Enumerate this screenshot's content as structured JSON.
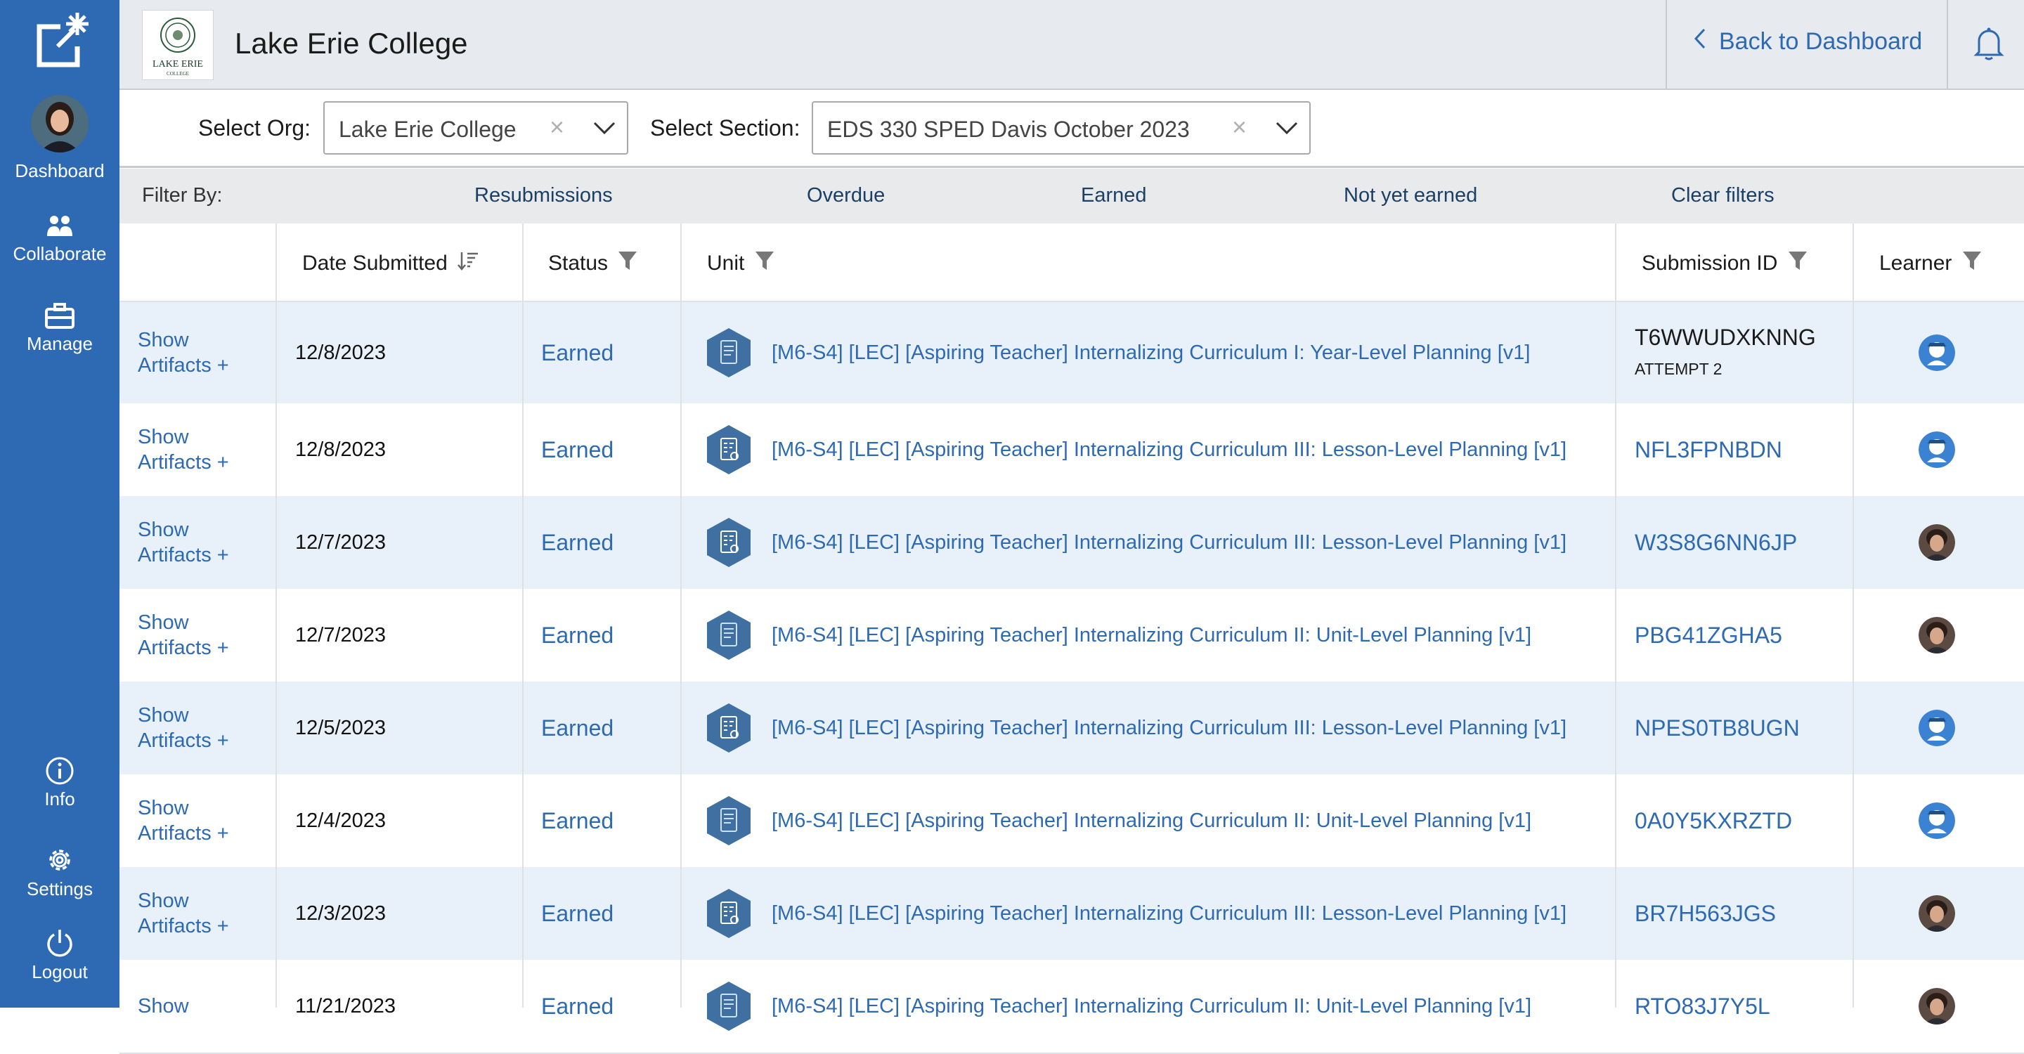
{
  "sidebar": {
    "items": [
      {
        "label": "Dashboard",
        "icon": "user-avatar"
      },
      {
        "label": "Collaborate",
        "icon": "people-icon"
      },
      {
        "label": "Manage",
        "icon": "briefcase-icon"
      },
      {
        "label": "Info",
        "icon": "info-icon"
      },
      {
        "label": "Settings",
        "icon": "gear-icon"
      },
      {
        "label": "Logout",
        "icon": "power-icon"
      }
    ]
  },
  "header": {
    "org_name": "Lake Erie College",
    "brand_text": "LAKE ERIE",
    "brand_subtext": "COLLEGE",
    "back_label": "Back to Dashboard"
  },
  "selects": {
    "org_label": "Select Org:",
    "org_value": "Lake Erie College",
    "section_label": "Select Section:",
    "section_value": "EDS 330 SPED Davis October 2023",
    "clear_glyph": "×"
  },
  "filters": {
    "label": "Filter By:",
    "resubmissions": "Resubmissions",
    "overdue": "Overdue",
    "earned": "Earned",
    "not_yet_earned": "Not yet earned",
    "clear": "Clear filters"
  },
  "table": {
    "columns": {
      "date": "Date Submitted",
      "status": "Status",
      "unit": "Unit",
      "submission_id": "Submission ID",
      "learner": "Learner"
    },
    "rows": [
      {
        "show": "Show Artifacts +",
        "date": "12/8/2023",
        "status": "Earned",
        "unit": "[M6-S4] [LEC] [Aspiring Teacher] Internalizing Curriculum I: Year-Level Planning [v1]",
        "submission_id": "T6WWUDXKNNG",
        "attempt": "ATTEMPT 2",
        "learner": "generic-avatar"
      },
      {
        "show": "Show Artifacts +",
        "date": "12/8/2023",
        "status": "Earned",
        "unit": "[M6-S4] [LEC] [Aspiring Teacher] Internalizing Curriculum III: Lesson-Level Planning [v1]",
        "submission_id": "NFL3FPNBDN",
        "learner": "generic-avatar"
      },
      {
        "show": "Show Artifacts +",
        "date": "12/7/2023",
        "status": "Earned",
        "unit": "[M6-S4] [LEC] [Aspiring Teacher] Internalizing Curriculum III: Lesson-Level Planning [v1]",
        "submission_id": "W3S8G6NN6JP",
        "learner": "photo-avatar"
      },
      {
        "show": "Show Artifacts +",
        "date": "12/7/2023",
        "status": "Earned",
        "unit": "[M6-S4] [LEC] [Aspiring Teacher] Internalizing Curriculum II: Unit-Level Planning [v1]",
        "submission_id": "PBG41ZGHA5",
        "learner": "photo-avatar"
      },
      {
        "show": "Show Artifacts +",
        "date": "12/5/2023",
        "status": "Earned",
        "unit": "[M6-S4] [LEC] [Aspiring Teacher] Internalizing Curriculum III: Lesson-Level Planning [v1]",
        "submission_id": "NPES0TB8UGN",
        "learner": "generic-avatar"
      },
      {
        "show": "Show Artifacts +",
        "date": "12/4/2023",
        "status": "Earned",
        "unit": "[M6-S4] [LEC] [Aspiring Teacher] Internalizing Curriculum II: Unit-Level Planning [v1]",
        "submission_id": "0A0Y5KXRZTD",
        "learner": "generic-avatar"
      },
      {
        "show": "Show Artifacts +",
        "date": "12/3/2023",
        "status": "Earned",
        "unit": "[M6-S4] [LEC] [Aspiring Teacher] Internalizing Curriculum III: Lesson-Level Planning [v1]",
        "submission_id": "BR7H563JGS",
        "learner": "photo-avatar"
      },
      {
        "show": "Show",
        "date": "11/21/2023",
        "status": "Earned",
        "unit": "[M6-S4] [LEC] [Aspiring Teacher] Internalizing Curriculum II: Unit-Level Planning [v1]",
        "submission_id": "RTO83J7Y5L",
        "learner": "photo-avatar"
      }
    ]
  },
  "colors": {
    "sidebar": "#2e6ab3",
    "link": "#2e6ab3",
    "row_alt": "#e8f1f9",
    "unit_icon": "#3f70a1"
  }
}
